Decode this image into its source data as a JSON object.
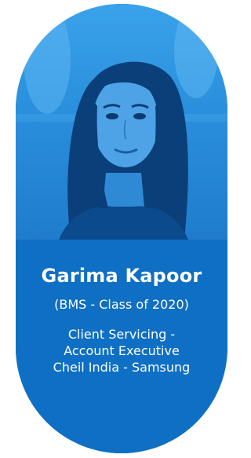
{
  "profile": {
    "name": "Garima Kapoor",
    "class": "(BMS - Class of 2020)",
    "role_lines": [
      "Client Servicing -",
      "Account Executive",
      "Cheil India - Samsung"
    ]
  },
  "colors": {
    "card_blue": "#0e6fc4",
    "photo_tint": "#2a8fdc",
    "text": "#ffffff"
  }
}
